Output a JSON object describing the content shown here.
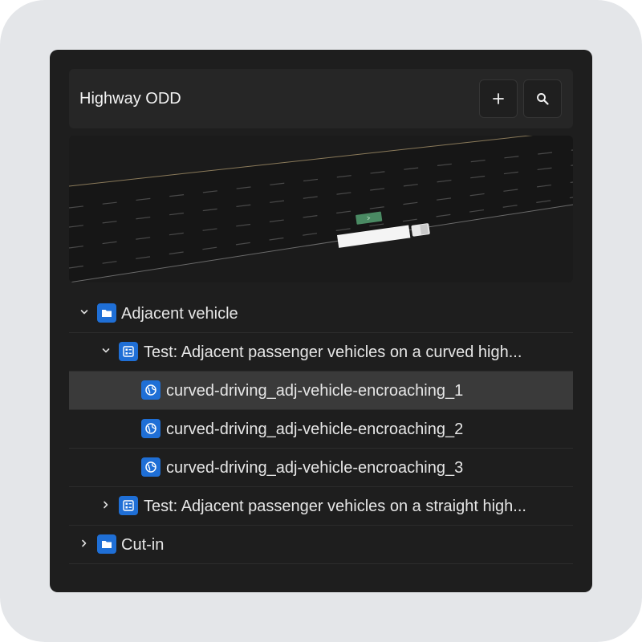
{
  "header": {
    "title": "Highway ODD",
    "add_icon": "plus-icon",
    "search_icon": "search-icon"
  },
  "tree": {
    "group_adjacent": {
      "label": "Adjacent vehicle",
      "icon": "folder-icon",
      "expanded": true
    },
    "test_curved": {
      "label": "Test: Adjacent passenger vehicles on a curved high...",
      "icon": "test-list-icon",
      "expanded": true
    },
    "scenarios": [
      {
        "label": "curved-driving_adj-vehicle-encroaching_1",
        "icon": "globe-icon",
        "selected": true
      },
      {
        "label": "curved-driving_adj-vehicle-encroaching_2",
        "icon": "globe-icon",
        "selected": false
      },
      {
        "label": "curved-driving_adj-vehicle-encroaching_3",
        "icon": "globe-icon",
        "selected": false
      }
    ],
    "test_straight": {
      "label": "Test: Adjacent passenger vehicles on a straight high...",
      "icon": "test-list-icon",
      "expanded": false
    },
    "group_cutin": {
      "label": "Cut-in",
      "icon": "folder-icon",
      "expanded": false
    }
  },
  "colors": {
    "accent": "#1f6fd6",
    "panel_bg": "#1e1e1e",
    "selected_row": "#3a3a3a"
  }
}
